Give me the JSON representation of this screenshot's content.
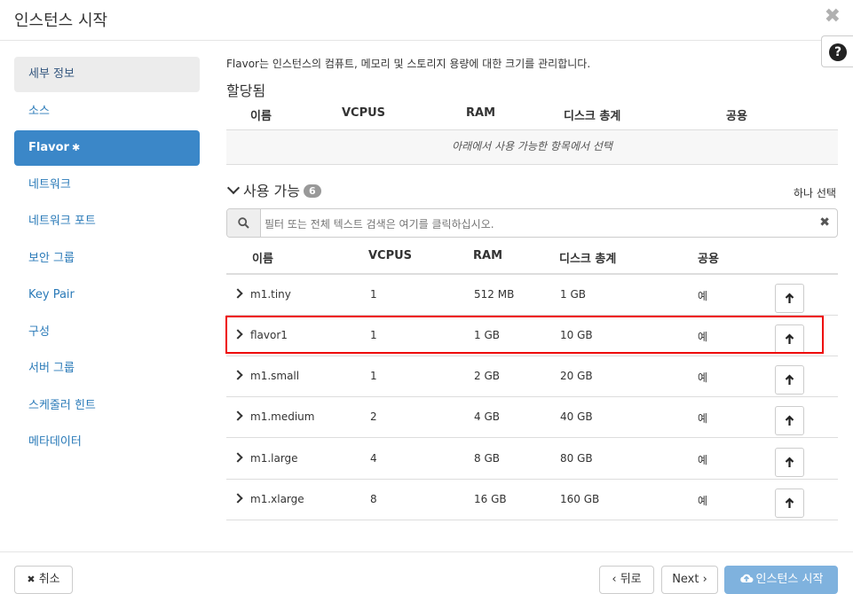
{
  "modal": {
    "title": "인스턴스 시작",
    "close_glyph": "✖",
    "help_glyph": "?"
  },
  "sidebar": {
    "items": [
      {
        "label": "세부 정보"
      },
      {
        "label": "소스"
      },
      {
        "label": "Flavor",
        "required": "✱"
      },
      {
        "label": "네트워크"
      },
      {
        "label": "네트워크 포트"
      },
      {
        "label": "보안 그룹"
      },
      {
        "label": "Key Pair"
      },
      {
        "label": "구성"
      },
      {
        "label": "서버 그룹"
      },
      {
        "label": "스케줄러 힌트"
      },
      {
        "label": "메타데이터"
      }
    ]
  },
  "main": {
    "description": "Flavor는 인스턴스의 컴퓨트, 메모리 및 스토리지 용량에 대한 크기를 관리합니다.",
    "allocated": {
      "title": "할당됨",
      "columns": [
        "이름",
        "VCPUS",
        "RAM",
        "디스크 총계",
        "공용"
      ],
      "empty_text": "아래에서 사용 가능한 항목에서 선택"
    },
    "available": {
      "title": "사용 가능",
      "count": "6",
      "pick_label": "하나 선택",
      "search_placeholder": "필터 또는 전체 텍스트 검색은 여기를 클릭하십시오.",
      "clear_glyph": "✖",
      "columns": [
        "이름",
        "VCPUS",
        "RAM",
        "디스크 총계",
        "공용"
      ],
      "rows": [
        {
          "name": "m1.tiny",
          "vcpus": "1",
          "ram": "512 MB",
          "disk": "1 GB",
          "public": "예"
        },
        {
          "name": "flavor1",
          "vcpus": "1",
          "ram": "1 GB",
          "disk": "10 GB",
          "public": "예"
        },
        {
          "name": "m1.small",
          "vcpus": "1",
          "ram": "2 GB",
          "disk": "20 GB",
          "public": "예"
        },
        {
          "name": "m1.medium",
          "vcpus": "2",
          "ram": "4 GB",
          "disk": "40 GB",
          "public": "예"
        },
        {
          "name": "m1.large",
          "vcpus": "4",
          "ram": "8 GB",
          "disk": "80 GB",
          "public": "예"
        },
        {
          "name": "m1.xlarge",
          "vcpus": "8",
          "ram": "16 GB",
          "disk": "160 GB",
          "public": "예"
        }
      ]
    }
  },
  "footer": {
    "cancel_label": "취소",
    "cancel_glyph": "✖",
    "back_label": "‹ 뒤로",
    "next_label": "Next ›",
    "launch_label": "인스턴스 시작"
  },
  "colors": {
    "active_nav": "#3b87c8",
    "link": "#2a7ab8",
    "highlight": "#e00000",
    "primary_disabled": "#7fb2de"
  }
}
